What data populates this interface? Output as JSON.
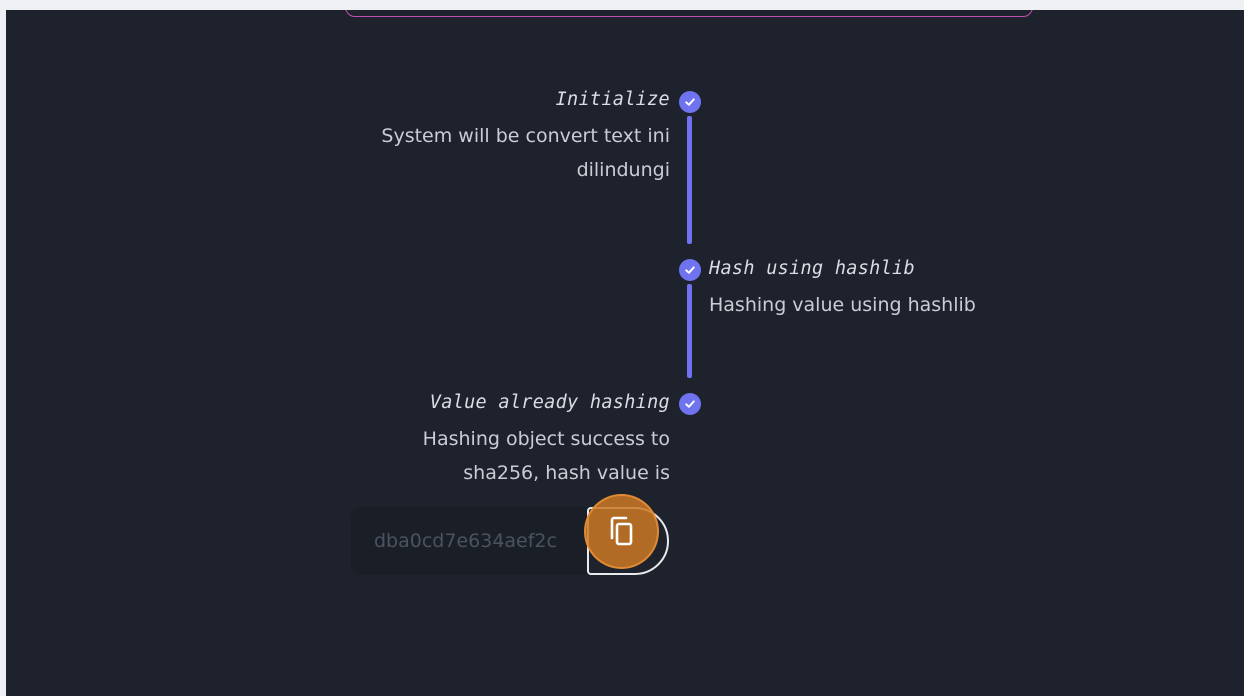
{
  "timeline": {
    "steps": [
      {
        "title": "Initialize",
        "desc_line1": "System will be convert text ini",
        "desc_line2": "dilindungi",
        "status_icon": "check-circle-icon"
      },
      {
        "title": "Hash using hashlib",
        "desc_line1": "Hashing value using hashlib",
        "status_icon": "check-circle-icon"
      },
      {
        "title": "Value already hashing",
        "desc_line1": "Hashing object success to",
        "desc_line2": "sha256, hash value is",
        "status_icon": "check-circle-icon"
      }
    ]
  },
  "hash_output": {
    "value": "dba0cd7e634aef2c",
    "copy_icon": "copy-icon"
  },
  "colors": {
    "background": "#1e222c",
    "accent": "#7073f0",
    "card_border": "#c14fb6",
    "copy_highlight": "#cb7824"
  }
}
